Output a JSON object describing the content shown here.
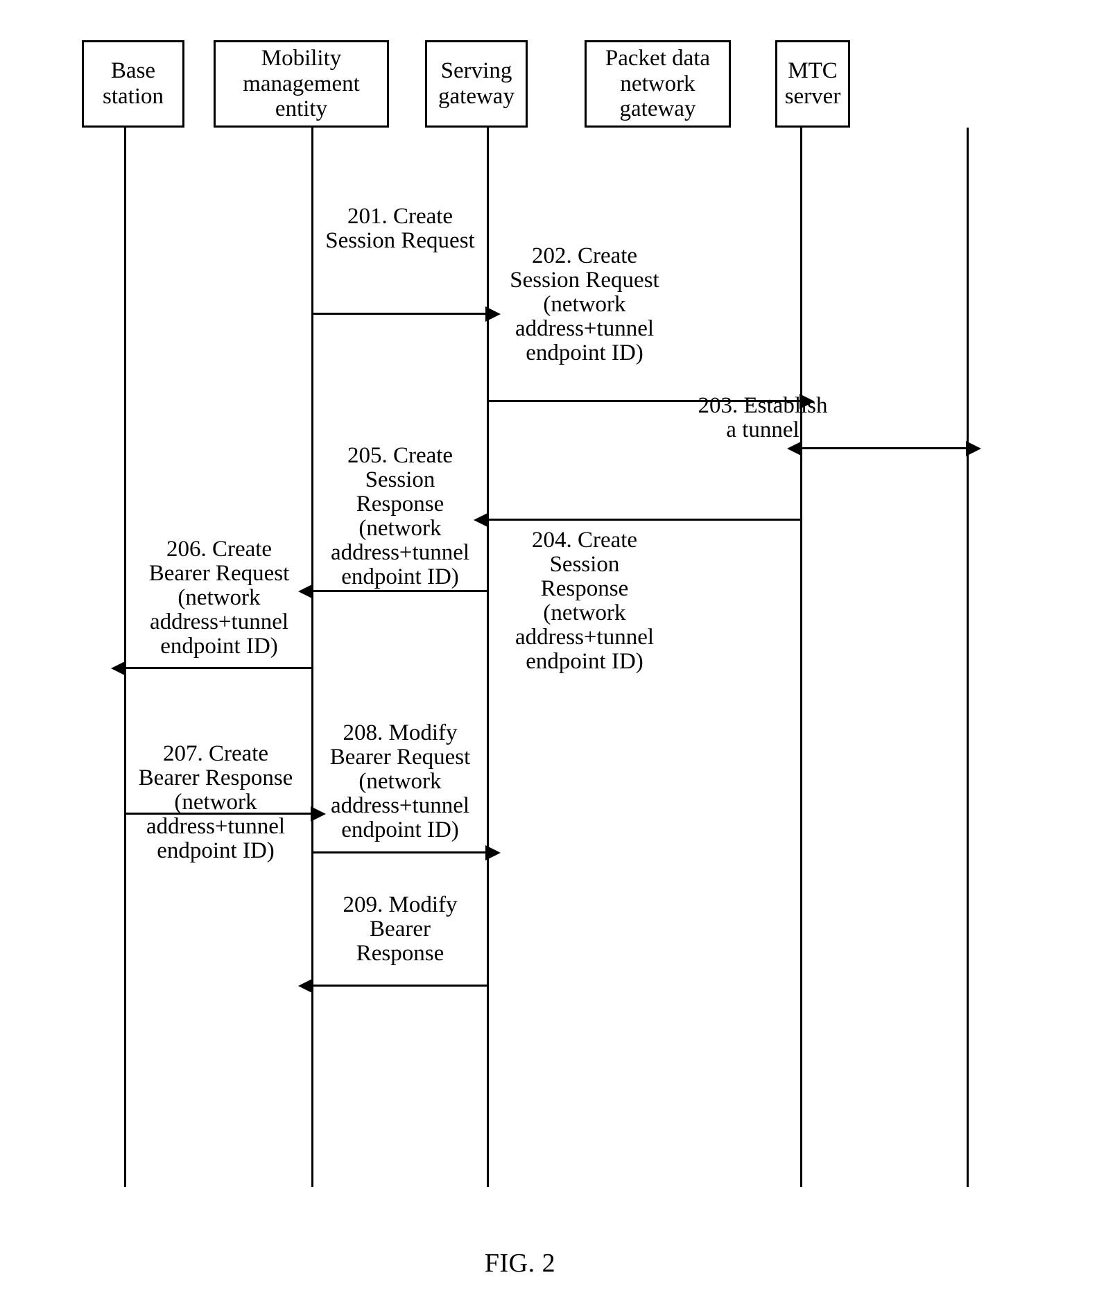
{
  "figure": {
    "caption": "FIG. 2",
    "type": "sequence-diagram"
  },
  "participants": [
    {
      "id": "base-station",
      "label": "Base\nstation"
    },
    {
      "id": "mme",
      "label": "Mobility\nmanagement\nentity"
    },
    {
      "id": "serving-gw",
      "label": "Serving\ngateway"
    },
    {
      "id": "pdn-gw",
      "label": "Packet data\nnetwork\ngateway"
    },
    {
      "id": "mtc-server",
      "label": "MTC\nserver"
    }
  ],
  "messages": [
    {
      "step": "201",
      "label": "201. Create\nSession Request",
      "from": "mme",
      "to": "serving-gw",
      "direction": "right"
    },
    {
      "step": "202",
      "label": "202. Create\nSession Request\n(network\naddress+tunnel\nendpoint ID)",
      "from": "serving-gw",
      "to": "pdn-gw",
      "direction": "right"
    },
    {
      "step": "203",
      "label": "203. Establish\na tunnel",
      "from": "pdn-gw",
      "to": "mtc-server",
      "direction": "both"
    },
    {
      "step": "204",
      "label": "204. Create\nSession\nResponse\n(network\naddress+tunnel\nendpoint ID)",
      "from": "pdn-gw",
      "to": "serving-gw",
      "direction": "left"
    },
    {
      "step": "205",
      "label": "205. Create\nSession\nResponse\n(network\naddress+tunnel\nendpoint ID)",
      "from": "serving-gw",
      "to": "mme",
      "direction": "left"
    },
    {
      "step": "206",
      "label": "206. Create\nBearer Request\n(network\naddress+tunnel\nendpoint ID)",
      "from": "mme",
      "to": "base-station",
      "direction": "left"
    },
    {
      "step": "207",
      "label": "207. Create\nBearer Response\n(network\naddress+tunnel\nendpoint ID)",
      "from": "base-station",
      "to": "mme",
      "direction": "right"
    },
    {
      "step": "208",
      "label": "208. Modify\nBearer Request\n(network\naddress+tunnel\nendpoint ID)",
      "from": "mme",
      "to": "serving-gw",
      "direction": "right"
    },
    {
      "step": "209",
      "label": "209. Modify\nBearer\nResponse",
      "from": "serving-gw",
      "to": "mme",
      "direction": "left"
    }
  ]
}
